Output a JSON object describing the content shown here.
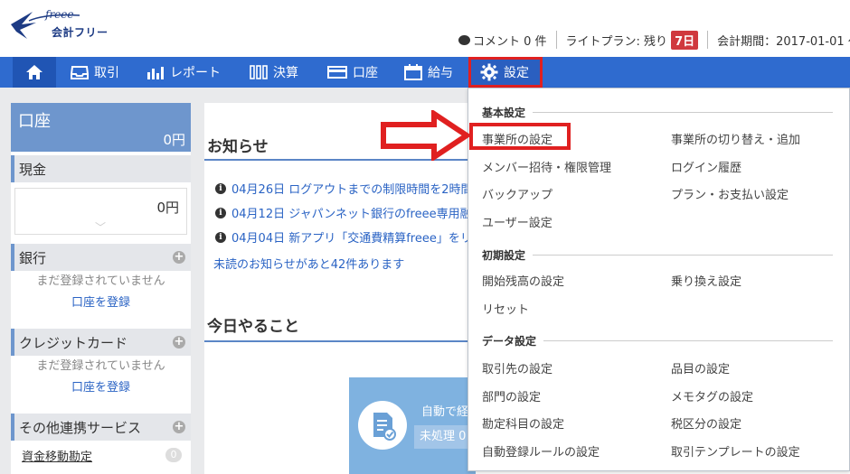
{
  "header": {
    "logo_brand": "freee",
    "logo_text": "会計フリー",
    "comment_label": "コメント 0 件",
    "plan_label": "ライトプラン: 残り",
    "plan_days": "7日",
    "period_label": "会計期間：2017-01-01 ～ 2"
  },
  "nav": {
    "items": [
      {
        "label": "取引",
        "icon": "inbox-icon"
      },
      {
        "label": "レポート",
        "icon": "chart-icon"
      },
      {
        "label": "決算",
        "icon": "books-icon"
      },
      {
        "label": "口座",
        "icon": "card-icon"
      },
      {
        "label": "給与",
        "icon": "calendar-icon"
      },
      {
        "label": "設定",
        "icon": "gear-icon"
      }
    ]
  },
  "sidebar": {
    "account_title": "口座",
    "account_total": "0円",
    "cash_title": "現金",
    "cash_value": "0円",
    "bank_title": "銀行",
    "bank_empty": "まだ登録されていません",
    "bank_link": "口座を登録",
    "card_title": "クレジットカード",
    "card_empty": "まだ登録されていません",
    "card_link": "口座を登録",
    "other_title": "その他連携サービス",
    "fund_label": "資金移動勘定",
    "fund_count": "0"
  },
  "main": {
    "news_title": "お知らせ",
    "news": [
      "04月26日 ログアウトまでの制限時間を2時間",
      "04月12日 ジャパンネット銀行のfreee専用融資",
      "04月04日 新アプリ「交通費精算freee」をリリ"
    ],
    "unread": "未読のお知らせがあと42件あります",
    "todo_title": "今日やること",
    "auto_text": "自動で経",
    "auto_btn": "未処理 0"
  },
  "dropdown": {
    "basic_head": "基本設定",
    "basic": [
      [
        "事業所の設定",
        "事業所の切り替え・追加"
      ],
      [
        "メンバー招待・権限管理",
        "ログイン履歴"
      ],
      [
        "バックアップ",
        "プラン・お支払い設定"
      ],
      [
        "ユーザー設定",
        ""
      ]
    ],
    "init_head": "初期設定",
    "init": [
      [
        "開始残高の設定",
        "乗り換え設定"
      ],
      [
        "リセット",
        ""
      ]
    ],
    "data_head": "データ設定",
    "data": [
      [
        "取引先の設定",
        "品目の設定"
      ],
      [
        "部門の設定",
        "メモタグの設定"
      ],
      [
        "勘定科目の設定",
        "税区分の設定"
      ],
      [
        "自動登録ルールの設定",
        "取引テンプレートの設定"
      ]
    ]
  },
  "colors": {
    "nav_bg": "#2f6bcf",
    "highlight_red": "#e02020",
    "link_blue": "#2a63c4"
  }
}
